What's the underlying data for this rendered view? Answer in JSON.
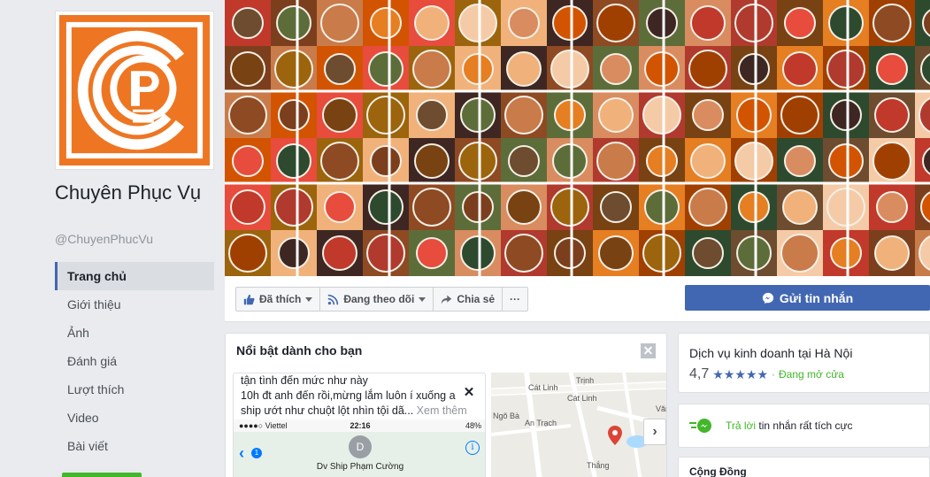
{
  "page": {
    "name": "Chuyên Phục Vụ",
    "handle": "@ChuyenPhucVu",
    "logo_bg": "#ee7622"
  },
  "sidebar": {
    "items": [
      {
        "label": "Trang chủ",
        "active": true
      },
      {
        "label": "Giới thiệu"
      },
      {
        "label": "Ảnh"
      },
      {
        "label": "Đánh giá"
      },
      {
        "label": "Lượt thích"
      },
      {
        "label": "Video"
      },
      {
        "label": "Bài viết"
      }
    ]
  },
  "actions": {
    "like": "Đã thích",
    "follow": "Đang theo dõi",
    "share": "Chia sẻ",
    "more": "···",
    "message": "Gửi tin nhắn"
  },
  "featured": {
    "title": "Nổi bật dành cho bạn",
    "close": "✕",
    "post_lines": [
      "tận tình đến mức như này",
      "10h đt anh đến rồi,mừng lắm luôn í xuống a",
      "ship ướt như chuột lột nhìn tội dã..."
    ],
    "see_more": "Xem thêm",
    "phone": {
      "carrier": "●●●●○ Viettel",
      "time": "22:16",
      "battery": "48%",
      "back_count": "1",
      "avatar_letter": "D",
      "contact": "Dv Ship Phạm Cường",
      "info_icon": "i"
    },
    "map_labels": [
      "Cát Linh",
      "Cát Linh",
      "Ngõ Bà",
      "Trịnh",
      "An Trạch",
      "Thắng",
      "Văn"
    ]
  },
  "right": {
    "business": "Dịch vụ kinh doanh tại Hà Nội",
    "rating": "4,7",
    "stars": "★★★★★",
    "separator": "·",
    "open_status": "Đang mở cửa",
    "response_highlight": "Trả lời",
    "response_rest": " tin nhắn rất tích cực",
    "community": "Cộng Đồng"
  },
  "colors": {
    "brand": "#4267b2",
    "green": "#42b72a",
    "page_bg": "#e9ebee"
  }
}
